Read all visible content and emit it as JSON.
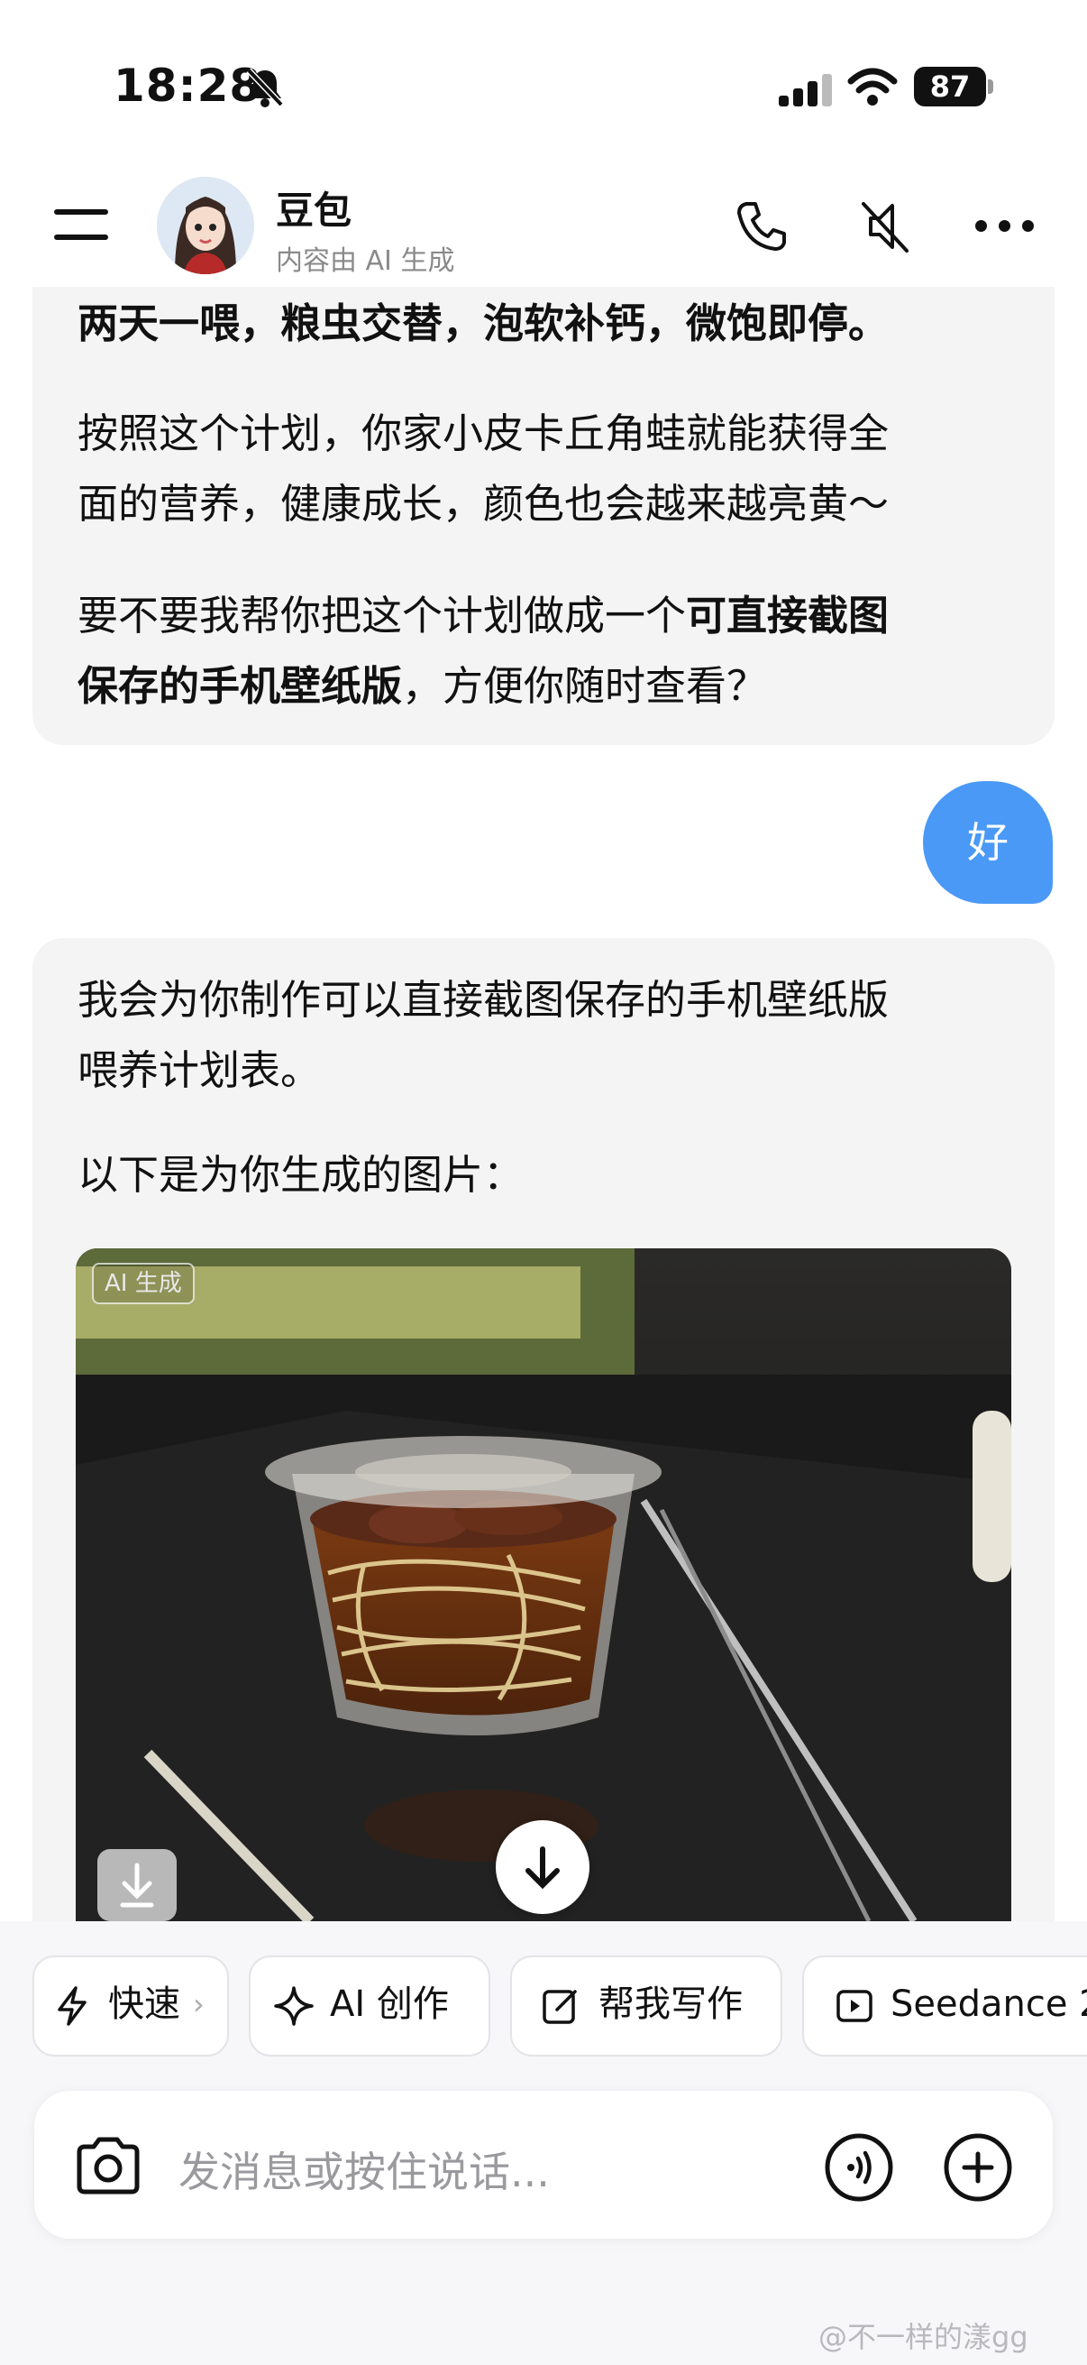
{
  "status_bar": {
    "time": "18:28",
    "battery": "87"
  },
  "header": {
    "name": "豆包",
    "subtitle": "内容由 AI 生成"
  },
  "messages": {
    "ai_1": {
      "p1": "两天一喂，粮虫交替，泡软补钙，微饱即停。",
      "p2_line1": "按照这个计划，你家小皮卡丘角蛙就能获得全",
      "p2_line2": "面的营养，健康成长，颜色也会越来越亮黄～",
      "p3_line1_a": "要不要我帮你把这个计划做成一个",
      "p3_line1_b": "可直接截图",
      "p3_line2_a": "保存的手机壁纸版",
      "p3_line2_b": "，方便你随时查看？"
    },
    "user_1": "好",
    "ai_2": {
      "p1_line1": "我会为你制作可以直接截图保存的手机壁纸版",
      "p1_line2": "喂养计划表。",
      "p2": "以下是为你生成的图片：",
      "image_badge": "AI 生成"
    }
  },
  "quick_actions": [
    {
      "label": "快速",
      "icon": "lightning-icon"
    },
    {
      "label": "AI 创作",
      "icon": "sparkle-icon"
    },
    {
      "label": "帮我写作",
      "icon": "edit-icon"
    },
    {
      "label": "Seedance 2",
      "icon": "video-icon"
    }
  ],
  "input": {
    "placeholder": "发消息或按住说话..."
  },
  "watermark": "@不一样的漾gg",
  "colors": {
    "user_bubble": "#4a99f7",
    "ai_bubble": "#f4f4f5"
  }
}
